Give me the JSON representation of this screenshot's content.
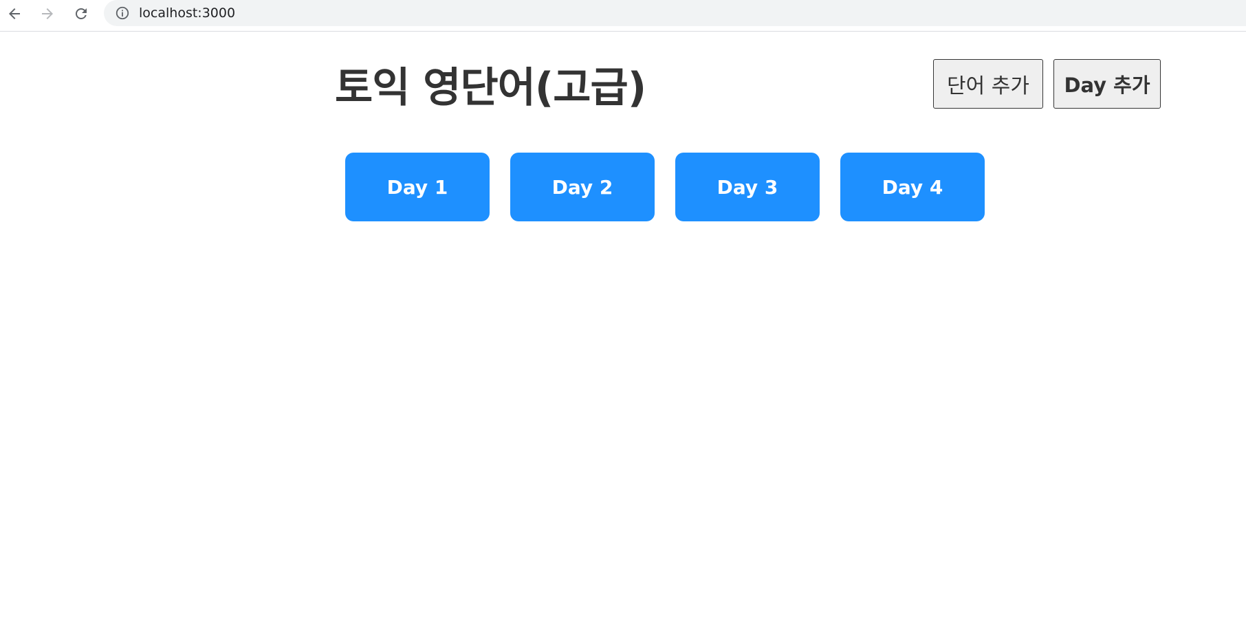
{
  "browser": {
    "url": "localhost:3000",
    "back_icon": "arrow-left-icon",
    "forward_icon": "arrow-right-icon",
    "reload_icon": "reload-icon",
    "info_icon": "info-icon"
  },
  "header": {
    "title": "토익 영단어(고급)",
    "add_word_label": "단어 추가",
    "add_day_label": "Day 추가"
  },
  "days": [
    {
      "label": "Day 1"
    },
    {
      "label": "Day 2"
    },
    {
      "label": "Day 3"
    },
    {
      "label": "Day 4"
    }
  ],
  "colors": {
    "day_card_bg": "#1e90ff",
    "title_text": "#333333",
    "button_bg": "#efefef"
  }
}
